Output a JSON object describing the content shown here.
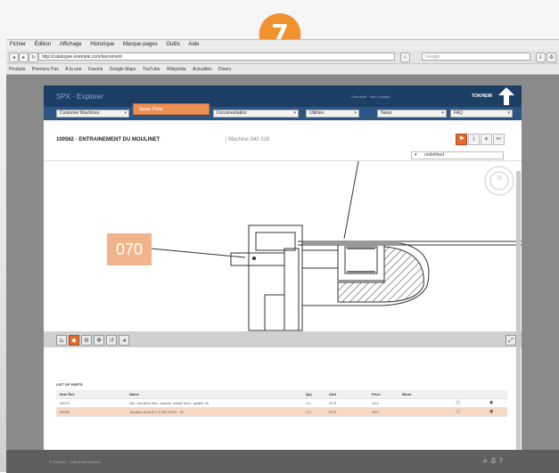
{
  "step": {
    "number": "7"
  },
  "browser": {
    "menu": [
      "Fichier",
      "Édition",
      "Affichage",
      "Historique",
      "Marque-pages",
      "Outils",
      "Aide"
    ],
    "url": "http://catalogue.exemple.com/lancement",
    "search_placeholder": "Google",
    "bookmarks": [
      "Produits",
      "Premiers Pas",
      "À la une",
      "Favoris",
      "Google Maps",
      "YouTube",
      "Wikipédia",
      "Actualités",
      "Divers"
    ]
  },
  "app": {
    "title": "SPX · Explorer",
    "user_info": "Connecté · Mon Compte",
    "brand": "TOKHEIM",
    "toolbar": {
      "select1": "Customer Machines",
      "select2": "Documentation",
      "select3": "Utilities",
      "select4": "News",
      "select5": "FAQ",
      "popup": "Spare Parts"
    },
    "doc": {
      "title": "100562 · ENTRAINEMENT DU MOULINET",
      "subtitle": "| Machine 540 316"
    },
    "filter": "undefined",
    "callout_label": "070",
    "compass": "70",
    "list": {
      "title": "LIST OF PARTS",
      "headers": [
        "Item Ref.",
        "Name",
        "Qty",
        "Unit",
        "Price",
        "Menu"
      ],
      "rows": [
        {
          "ref": "00070",
          "name": "Vis / moulinet élec. entraîn. axiale fonct. qualité 40",
          "qty": "1.0",
          "unit": "PCS",
          "price": "16.0"
        },
        {
          "ref": "00050",
          "name": "Tourillon droit Ø 2.0 ISO 8734 - 10",
          "qty": "1.0",
          "unit": "PCS",
          "price": "18.0"
        }
      ]
    },
    "footer": "© Tokheim · Tous droits réservés"
  }
}
